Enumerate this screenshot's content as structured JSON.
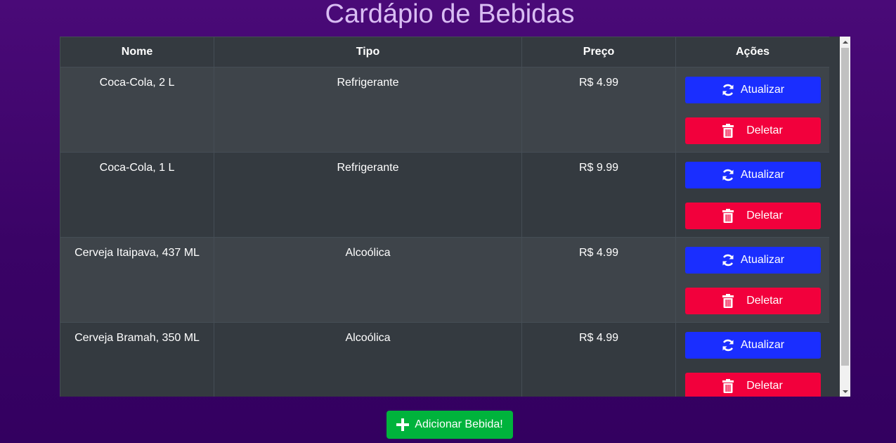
{
  "page": {
    "title": "Cardápio de Bebidas"
  },
  "table": {
    "headers": [
      "Nome",
      "Tipo",
      "Preço",
      "Ações"
    ],
    "rows": [
      {
        "nome": "Coca-Cola, 2 L",
        "tipo": "Refrigerante",
        "preco": "R$ 4.99"
      },
      {
        "nome": "Coca-Cola, 1 L",
        "tipo": "Refrigerante",
        "preco": "R$ 9.99"
      },
      {
        "nome": "Cerveja Itaipava, 437 ML",
        "tipo": "Alcoólica",
        "preco": "R$ 4.99"
      },
      {
        "nome": "Cerveja Bramah, 350 ML",
        "tipo": "Alcoólica",
        "preco": "R$ 4.99"
      }
    ]
  },
  "actions": {
    "update_label": "Atualizar",
    "delete_label": "Deletar",
    "update_icon": "refresh-icon",
    "delete_icon": "trash-icon"
  },
  "footer": {
    "add_label": "Adicionar Bebida!",
    "add_icon": "plus-icon"
  },
  "colors": {
    "update": "#1a2eff",
    "delete": "#f2003c",
    "add": "#00b33c",
    "table_bg": "#343a40",
    "title": "#d9bdf3"
  }
}
